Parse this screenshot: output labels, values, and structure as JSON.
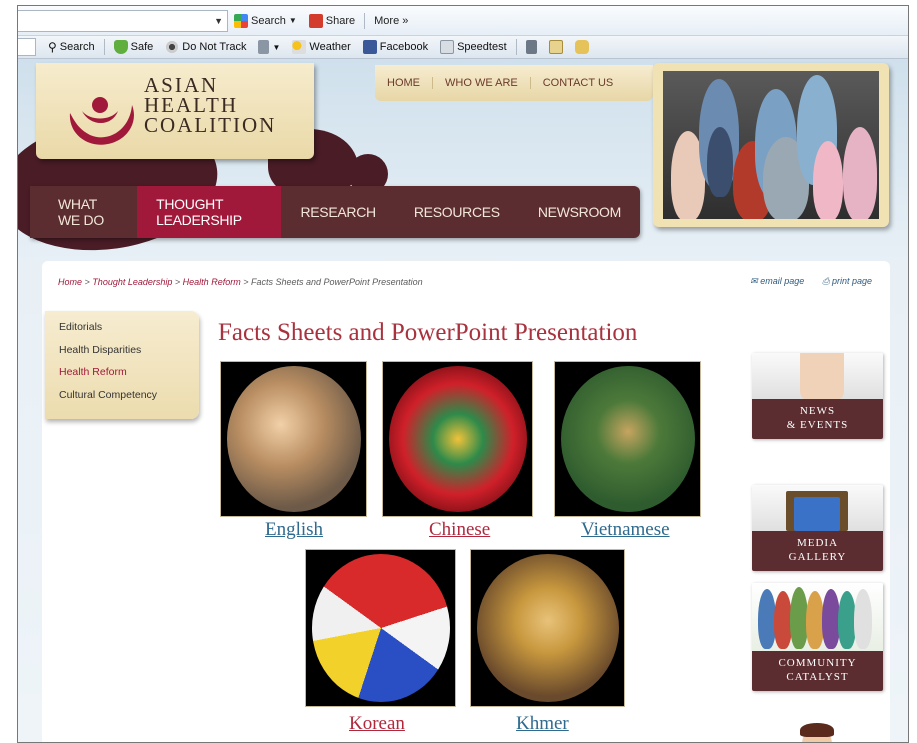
{
  "toolbar1": {
    "search_label": "Search",
    "share_label": "Share",
    "more_label": "More »"
  },
  "toolbar2": {
    "items": [
      "Search",
      "Safe",
      "Do Not Track",
      "Weather",
      "Facebook",
      "Speedtest"
    ]
  },
  "site": {
    "logo_lines": [
      "ASIAN",
      "HEALTH",
      "COALITION"
    ],
    "top_nav": [
      "HOME",
      "WHO WE ARE",
      "CONTACT US"
    ],
    "main_nav": [
      "WHAT WE DO",
      "THOUGHT LEADERSHIP",
      "RESEARCH",
      "RESOURCES",
      "NEWSROOM"
    ],
    "active_main_nav": "THOUGHT LEADERSHIP",
    "breadcrumb": {
      "links": [
        "Home",
        "Thought Leadership",
        "Health Reform"
      ],
      "current": "Facts Sheets and PowerPoint Presentation",
      "separator": ">"
    },
    "email_label": "email page",
    "print_label": "print page",
    "left_nav": [
      "Editorials",
      "Health Disparities",
      "Health Reform",
      "Cultural Competency"
    ],
    "left_nav_selected": "Health Reform",
    "page_title": "Facts Sheets and PowerPoint Presentation",
    "languages": [
      "English",
      "Chinese",
      "Vietnamese",
      "Korean",
      "Khmer"
    ],
    "side_tiles": [
      {
        "line1": "NEWS",
        "line2": "& EVENTS"
      },
      {
        "line1": "MEDIA",
        "line2": "GALLERY"
      },
      {
        "line1": "COMMUNITY",
        "line2": "CATALYST"
      }
    ]
  },
  "colors": {
    "brand_maroon": "#5b2c30",
    "accent_red": "#a0193a",
    "cream": "#f6ecd0",
    "link_blue": "#2f6a8f",
    "link_red": "#b0283c"
  }
}
